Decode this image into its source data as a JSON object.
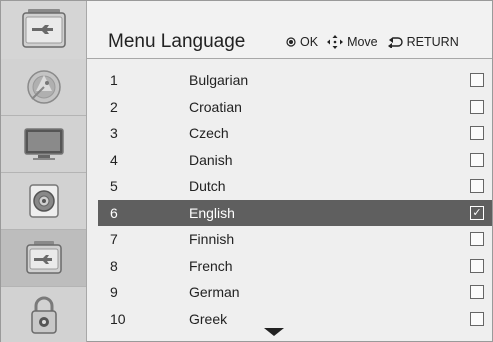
{
  "header": {
    "icon": "toolbox-icon",
    "title": "Menu Language",
    "hints": [
      {
        "icon": "ok-icon",
        "label": "OK"
      },
      {
        "icon": "move-icon",
        "label": "Move"
      },
      {
        "icon": "return-icon",
        "label": "RETURN"
      }
    ]
  },
  "sidebar": {
    "items": [
      {
        "icon": "satellite-dish-icon",
        "active": false
      },
      {
        "icon": "tv-screen-icon",
        "active": false
      },
      {
        "icon": "speaker-icon",
        "active": false
      },
      {
        "icon": "toolbox-icon",
        "active": true
      },
      {
        "icon": "lock-icon",
        "active": false
      }
    ]
  },
  "languages": [
    {
      "num": "1",
      "name": "Bulgarian",
      "checked": false
    },
    {
      "num": "2",
      "name": "Croatian",
      "checked": false
    },
    {
      "num": "3",
      "name": "Czech",
      "checked": false
    },
    {
      "num": "4",
      "name": "Danish",
      "checked": false
    },
    {
      "num": "5",
      "name": "Dutch",
      "checked": false
    },
    {
      "num": "6",
      "name": "English",
      "checked": true,
      "selected": true
    },
    {
      "num": "7",
      "name": "Finnish",
      "checked": false
    },
    {
      "num": "8",
      "name": "French",
      "checked": false
    },
    {
      "num": "9",
      "name": "German",
      "checked": false
    },
    {
      "num": "10",
      "name": "Greek",
      "checked": false
    }
  ],
  "check_mark": "✓",
  "colors": {
    "selected_row": "#5f5f5f",
    "sidebar_bg": "#d2d2d2",
    "sidebar_active": "#bdbdbd"
  }
}
